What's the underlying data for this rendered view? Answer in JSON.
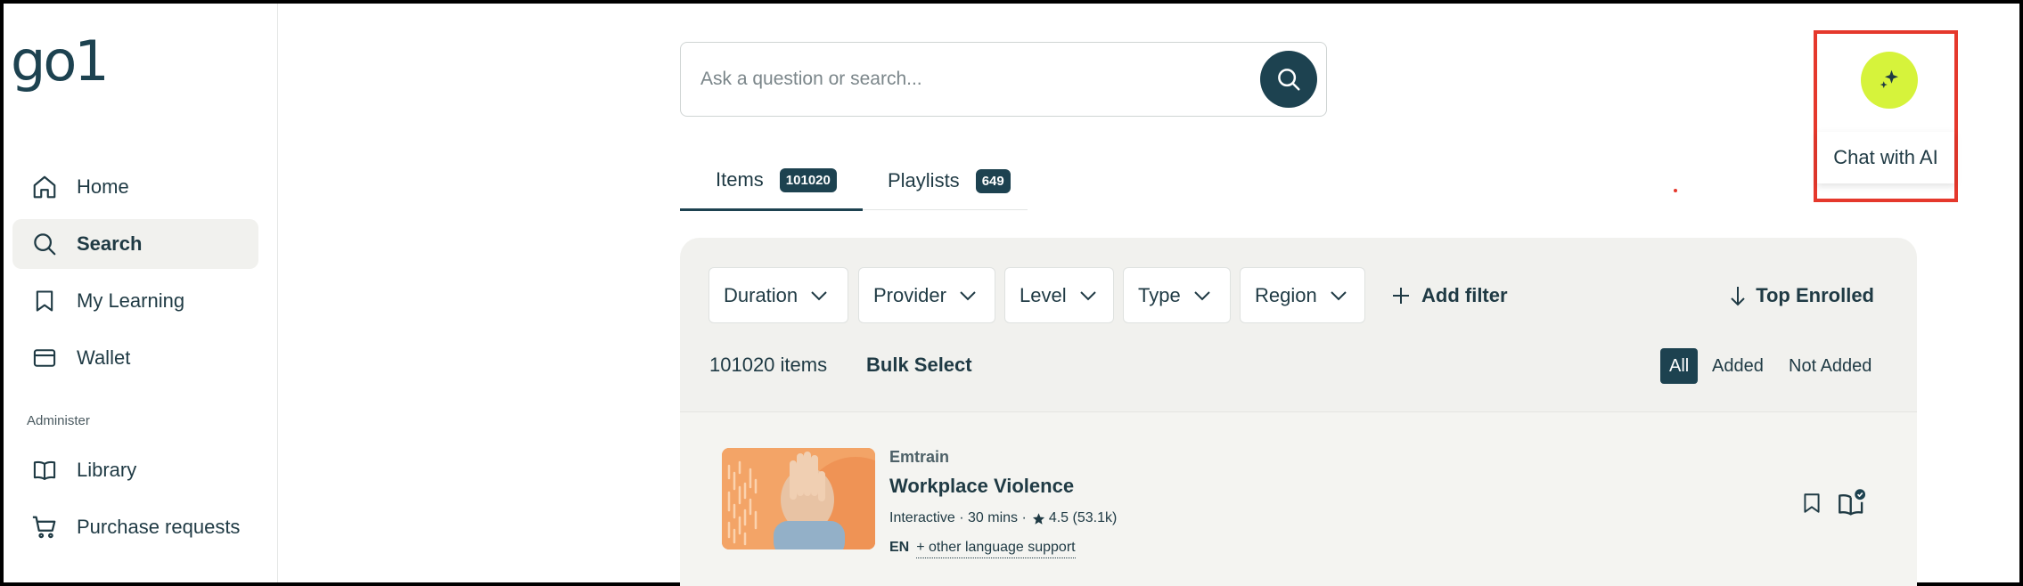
{
  "brand": {
    "logo_text": "go1"
  },
  "sidebar": {
    "items": [
      {
        "label": "Home",
        "icon": "home-icon"
      },
      {
        "label": "Search",
        "icon": "search-icon"
      },
      {
        "label": "My Learning",
        "icon": "bookmark-icon"
      },
      {
        "label": "Wallet",
        "icon": "wallet-icon"
      }
    ],
    "section_label": "Administer",
    "admin_items": [
      {
        "label": "Library",
        "icon": "book-icon"
      },
      {
        "label": "Purchase requests",
        "icon": "cart-icon"
      }
    ]
  },
  "search": {
    "placeholder": "Ask a question or search..."
  },
  "tabs": [
    {
      "label": "Items",
      "count": "101020"
    },
    {
      "label": "Playlists",
      "count": "649"
    }
  ],
  "ai": {
    "tooltip": "Chat with AI"
  },
  "filters": {
    "items": [
      "Duration",
      "Provider",
      "Level",
      "Type",
      "Region"
    ],
    "add_filter": "Add filter",
    "sort": "Top Enrolled"
  },
  "results": {
    "count_label": "101020 items",
    "bulk_select": "Bulk Select",
    "segments": [
      "All",
      "Added",
      "Not Added"
    ]
  },
  "card": {
    "provider": "Emtrain",
    "title": "Workplace Violence",
    "meta": "Interactive · 30 mins ·",
    "rating": "4.5 (53.1k)",
    "lang": "EN",
    "lang_more": "+ other language support"
  },
  "colors": {
    "accent": "#1d4250",
    "ai": "#d6f33b",
    "highlight": "#e5382c",
    "panel": "#f1f1ee"
  }
}
